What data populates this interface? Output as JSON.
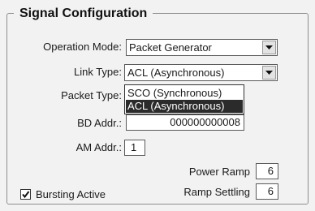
{
  "group_title": "Signal Configuration",
  "operation_mode": {
    "label": "Operation Mode:",
    "value": "Packet Generator"
  },
  "link_type": {
    "label": "Link Type:",
    "value": "ACL (Asynchronous)"
  },
  "packet_type": {
    "label": "Packet Type:",
    "options": [
      "SCO (Synchronous)",
      "ACL (Asynchronous)"
    ],
    "selected_index": 1
  },
  "bd_addr": {
    "label": "BD Addr.:",
    "value": "000000000008"
  },
  "am_addr": {
    "label": "AM Addr.:",
    "value": "1"
  },
  "power_ramp": {
    "label": "Power Ramp",
    "value": "6"
  },
  "ramp_settling": {
    "label": "Ramp Settling",
    "value": "6"
  },
  "bursting_active": {
    "label": "Bursting Active",
    "checked": true
  }
}
